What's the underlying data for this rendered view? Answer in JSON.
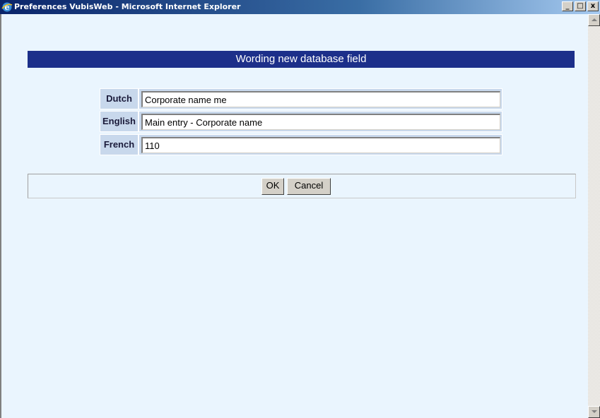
{
  "window": {
    "title": "Preferences VubisWeb - Microsoft Internet Explorer",
    "controls": {
      "minimize": "_",
      "maximize": "□",
      "close": "x"
    }
  },
  "page": {
    "header": "Wording new database field",
    "fields": [
      {
        "label": "Dutch",
        "value": "Corporate name me"
      },
      {
        "label": "English",
        "value": "Main entry - Corporate name"
      },
      {
        "label": "French",
        "value": "110"
      }
    ],
    "buttons": {
      "ok": "OK",
      "cancel": "Cancel"
    }
  },
  "colors": {
    "header_bg": "#1c2f8a",
    "content_bg": "#eaf5fe",
    "label_bg": "#c8d8ec"
  }
}
